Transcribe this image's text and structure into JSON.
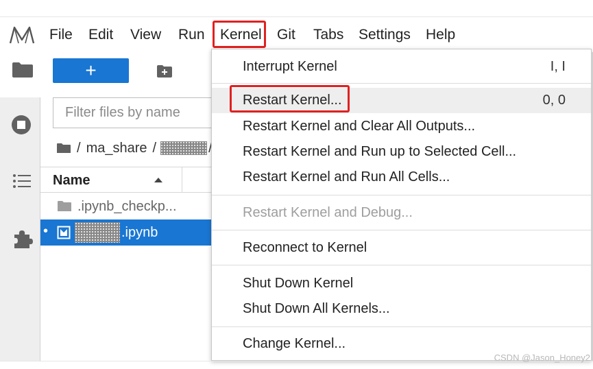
{
  "menubar": {
    "items": [
      {
        "label": "File"
      },
      {
        "label": "Edit"
      },
      {
        "label": "View"
      },
      {
        "label": "Run"
      },
      {
        "label": "Kernel"
      },
      {
        "label": "Git"
      },
      {
        "label": "Tabs"
      },
      {
        "label": "Settings"
      },
      {
        "label": "Help"
      }
    ],
    "highlighted": "Kernel"
  },
  "toolbar": {
    "new_label": "+"
  },
  "file_browser": {
    "filter_placeholder": "Filter files by name",
    "breadcrumb": {
      "root_sep": "/",
      "folder": "ma_share",
      "sep": "/",
      "trailing_sep": "/"
    },
    "header": {
      "name_label": "Name",
      "sort": "ascending"
    },
    "rows": [
      {
        "label": ".ipynb_checkp...",
        "icon": "folder-icon",
        "selected": false
      },
      {
        "label": ".ipynb",
        "icon": "notebook-icon",
        "selected": true,
        "running_dot": "•"
      }
    ]
  },
  "kernel_menu": {
    "groups": [
      [
        {
          "label": "Interrupt Kernel",
          "shortcut": "I, I",
          "enabled": true
        }
      ],
      [
        {
          "label": "Restart Kernel...",
          "shortcut": "0, 0",
          "enabled": true,
          "active": true
        },
        {
          "label": "Restart Kernel and Clear All Outputs...",
          "shortcut": "",
          "enabled": true
        },
        {
          "label": "Restart Kernel and Run up to Selected Cell...",
          "shortcut": "",
          "enabled": true
        },
        {
          "label": "Restart Kernel and Run All Cells...",
          "shortcut": "",
          "enabled": true
        }
      ],
      [
        {
          "label": "Restart Kernel and Debug...",
          "shortcut": "",
          "enabled": false
        }
      ],
      [
        {
          "label": "Reconnect to Kernel",
          "shortcut": "",
          "enabled": true
        }
      ],
      [
        {
          "label": "Shut Down Kernel",
          "shortcut": "",
          "enabled": true
        },
        {
          "label": "Shut Down All Kernels...",
          "shortcut": "",
          "enabled": true
        }
      ],
      [
        {
          "label": "Change Kernel...",
          "shortcut": "",
          "enabled": true
        }
      ]
    ]
  },
  "colors": {
    "accent": "#1976d2",
    "highlight_box": "#e02020",
    "disabled_text": "#9e9e9e"
  },
  "watermark": "CSDN @Jason_Honey2"
}
